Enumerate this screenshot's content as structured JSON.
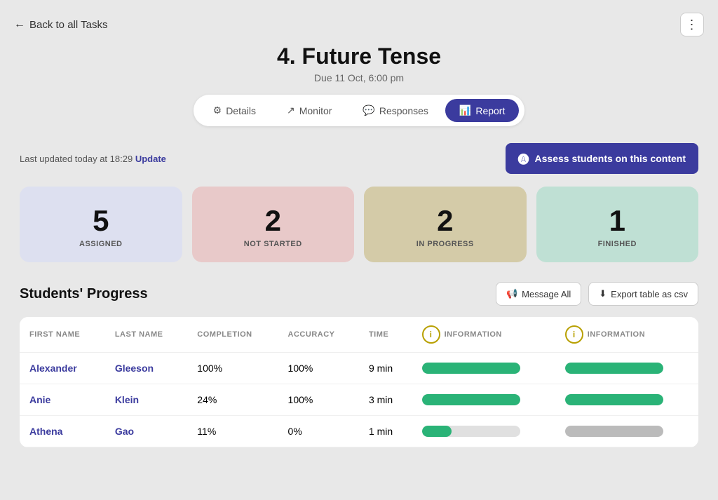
{
  "back": {
    "label": "Back to all Tasks"
  },
  "more_button": "⋮",
  "page": {
    "title": "4. Future Tense",
    "due": "Due 11 Oct, 6:00 pm"
  },
  "tabs": [
    {
      "id": "details",
      "label": "Details",
      "icon": "⚙"
    },
    {
      "id": "monitor",
      "label": "Monitor",
      "icon": "↗"
    },
    {
      "id": "responses",
      "label": "Responses",
      "icon": "💬"
    },
    {
      "id": "report",
      "label": "Report",
      "icon": "📊",
      "active": true
    }
  ],
  "update_text": "Last updated today at 18:29",
  "update_link": "Update",
  "assess_btn": "Assess students on this content",
  "stats": [
    {
      "id": "assigned",
      "number": "5",
      "label": "ASSIGNED",
      "class": "assigned"
    },
    {
      "id": "not-started",
      "number": "2",
      "label": "NOT STARTED",
      "class": "not-started"
    },
    {
      "id": "in-progress",
      "number": "2",
      "label": "IN PROGRESS",
      "class": "in-progress"
    },
    {
      "id": "finished",
      "number": "1",
      "label": "FINISHED",
      "class": "finished"
    }
  ],
  "students_section": {
    "title": "Students' Progress",
    "message_all": "Message All",
    "export_csv": "Export table as csv"
  },
  "table": {
    "headers": [
      "FIRST NAME",
      "LAST NAME",
      "COMPLETION",
      "ACCURACY",
      "TIME",
      "INFORMATION",
      "INFORMATION"
    ],
    "rows": [
      {
        "first": "Alexander",
        "last": "Gleeson",
        "completion": "100%",
        "accuracy": "100%",
        "time": "9 min",
        "bar1": 100,
        "bar2": 100,
        "bar1_gray": false,
        "bar2_gray": false
      },
      {
        "first": "Anie",
        "last": "Klein",
        "completion": "24%",
        "accuracy": "100%",
        "time": "3 min",
        "bar1": 100,
        "bar2": 100,
        "bar1_gray": false,
        "bar2_gray": false
      },
      {
        "first": "Athena",
        "last": "Gao",
        "completion": "11%",
        "accuracy": "0%",
        "time": "1 min",
        "bar1": 30,
        "bar2": 0,
        "bar1_gray": false,
        "bar2_gray": true
      }
    ]
  }
}
